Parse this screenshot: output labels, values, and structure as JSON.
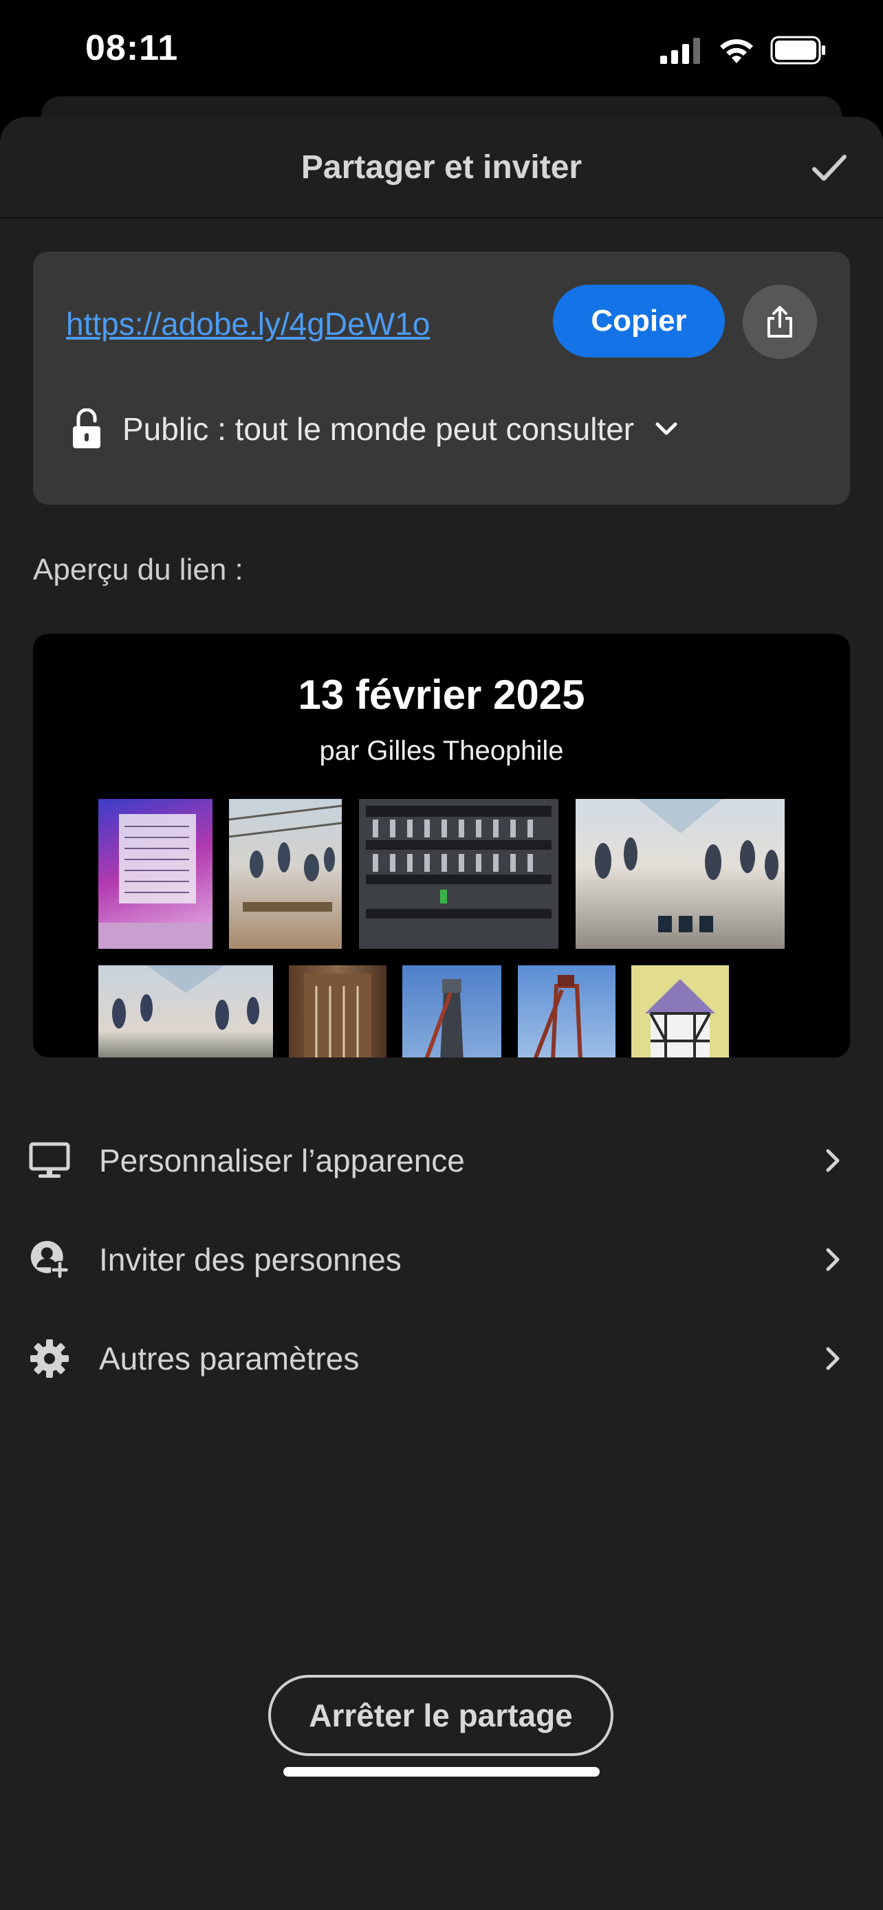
{
  "status_bar": {
    "time": "08:11"
  },
  "header": {
    "title": "Partager et inviter"
  },
  "link_card": {
    "url": "https://adobe.ly/4gDeW1o",
    "copy_label": "Copier",
    "access_label": "Public : tout le monde peut consulter"
  },
  "preview": {
    "label": "Aperçu du lien :",
    "title": "13 février 2025",
    "author": "par Gilles Theophile"
  },
  "menu": {
    "items": [
      {
        "label": "Personnaliser l’apparence",
        "icon": "monitor-icon"
      },
      {
        "label": "Inviter des personnes",
        "icon": "add-person-icon"
      },
      {
        "label": "Autres paramètres",
        "icon": "gear-icon"
      }
    ]
  },
  "stop_button_label": "Arrêter le partage",
  "colors": {
    "accent": "#1473e6",
    "link": "#4b9cf5",
    "sheet_bg": "#1f1f1f",
    "card_bg": "#383838"
  }
}
